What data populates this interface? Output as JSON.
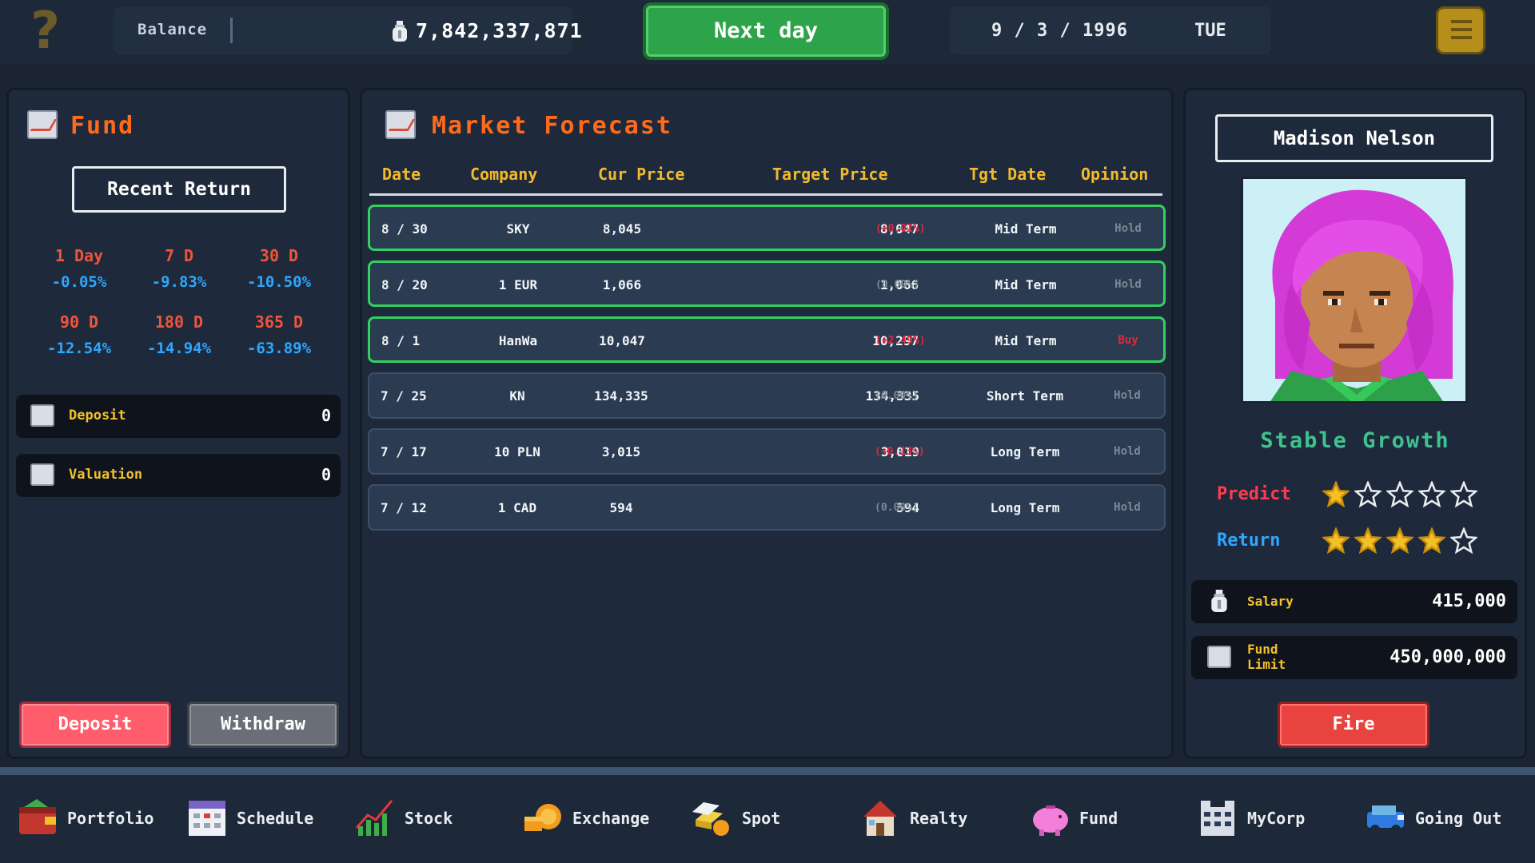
{
  "top_bar": {
    "balance_label": "Balance",
    "balance_value": "7,842,337,871",
    "next_day_label": "Next day",
    "date": "9 / 3 / 1996",
    "weekday": "TUE"
  },
  "fund_panel": {
    "title": "Fund",
    "recent_return_label": "Recent Return",
    "returns": [
      {
        "period": "1 Day",
        "value": "-0.05%"
      },
      {
        "period": "7 D",
        "value": "-9.83%"
      },
      {
        "period": "30 D",
        "value": "-10.50%"
      },
      {
        "period": "90 D",
        "value": "-12.54%"
      },
      {
        "period": "180 D",
        "value": "-14.94%"
      },
      {
        "period": "365 D",
        "value": "-63.89%"
      }
    ],
    "deposit_label": "Deposit",
    "deposit_value": "0",
    "valuation_label": "Valuation",
    "valuation_value": "0",
    "deposit_button": "Deposit",
    "withdraw_button": "Withdraw"
  },
  "forecast_panel": {
    "title": "Market Forecast",
    "columns": [
      "Date",
      "Company",
      "Cur Price",
      "Target Price",
      "Tgt Date",
      "Opinion"
    ],
    "rows": [
      {
        "date": "8 / 30",
        "company": "SKY",
        "cur_price": "8,045",
        "target_price": "8,047",
        "change": "(+0.02%)",
        "change_color": "#e8263a",
        "tgt_date": "Mid Term",
        "opinion": "Hold",
        "opinion_color": "#7e8894",
        "highlighted": true
      },
      {
        "date": "8 / 20",
        "company": "1 EUR",
        "cur_price": "1,066",
        "target_price": "1,066",
        "change": "(0.00%)",
        "change_color": "#7e8894",
        "tgt_date": "Mid Term",
        "opinion": "Hold",
        "opinion_color": "#7e8894",
        "highlighted": true
      },
      {
        "date": "8 / 1",
        "company": "HanWa",
        "cur_price": "10,047",
        "target_price": "10,297",
        "change": "(+2.49%)",
        "change_color": "#e8263a",
        "tgt_date": "Mid Term",
        "opinion": "Buy",
        "opinion_color": "#e8263a",
        "highlighted": true
      },
      {
        "date": "7 / 25",
        "company": "KN",
        "cur_price": "134,335",
        "target_price": "134,335",
        "change": "(0.00%)",
        "change_color": "#7e8894",
        "tgt_date": "Short Term",
        "opinion": "Hold",
        "opinion_color": "#7e8894",
        "highlighted": false
      },
      {
        "date": "7 / 17",
        "company": "10 PLN",
        "cur_price": "3,015",
        "target_price": "3,019",
        "change": "(+0.13%)",
        "change_color": "#e8263a",
        "tgt_date": "Long Term",
        "opinion": "Hold",
        "opinion_color": "#7e8894",
        "highlighted": false
      },
      {
        "date": "7 / 12",
        "company": "1 CAD",
        "cur_price": "594",
        "target_price": "594",
        "change": "(0.00%)",
        "change_color": "#7e8894",
        "tgt_date": "Long Term",
        "opinion": "Hold",
        "opinion_color": "#7e8894",
        "highlighted": false
      }
    ]
  },
  "manager_panel": {
    "name": "Madison Nelson",
    "style": "Stable Growth",
    "predict_label": "Predict",
    "predict_stars": 1,
    "return_label": "Return",
    "return_stars": 4,
    "max_stars": 5,
    "salary_label": "Salary",
    "salary_value": "415,000",
    "fund_limit_label_1": "Fund",
    "fund_limit_label_2": "Limit",
    "fund_limit_value": "450,000,000",
    "fire_button": "Fire"
  },
  "bottom_nav": [
    {
      "label": "Portfolio",
      "icon": "wallet-icon"
    },
    {
      "label": "Schedule",
      "icon": "calendar-icon"
    },
    {
      "label": "Stock",
      "icon": "stock-chart-icon"
    },
    {
      "label": "Exchange",
      "icon": "coins-icon"
    },
    {
      "label": "Spot",
      "icon": "gold-bars-icon"
    },
    {
      "label": "Realty",
      "icon": "house-icon"
    },
    {
      "label": "Fund",
      "icon": "piggy-bank-icon"
    },
    {
      "label": "MyCorp",
      "icon": "office-building-icon"
    },
    {
      "label": "Going Out",
      "icon": "car-icon"
    }
  ],
  "colors": {
    "accent_orange": "#ff6a1a",
    "header_gold": "#f3b92a",
    "negative_blue": "#2ea7ff",
    "positive_red": "#e8263a",
    "highlight_green": "#33d060"
  }
}
